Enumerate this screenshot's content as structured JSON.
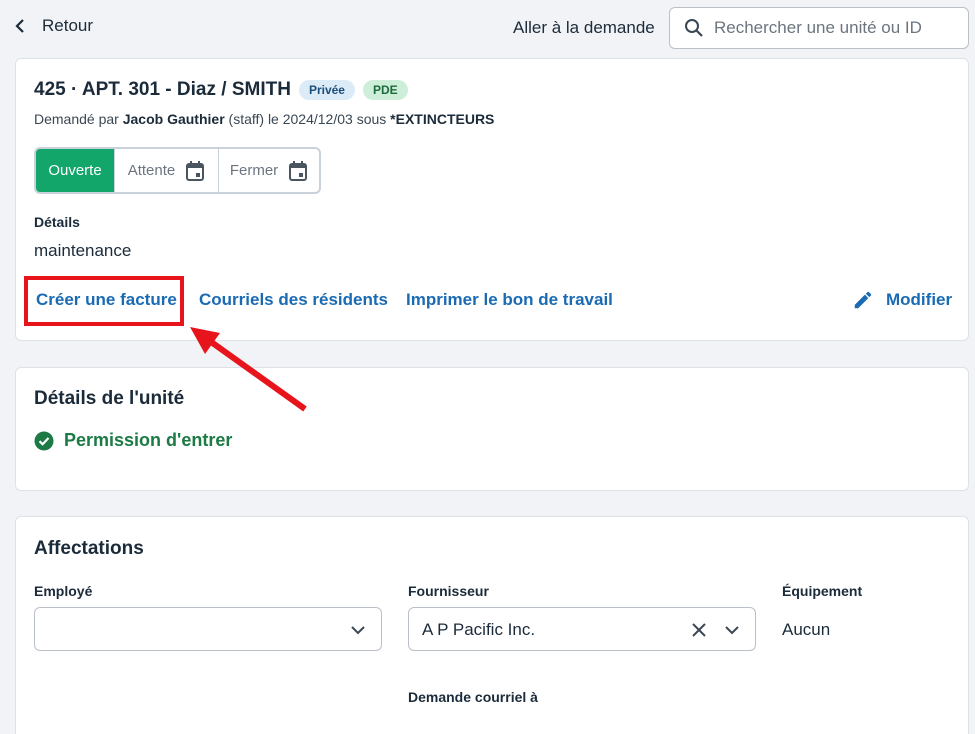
{
  "topbar": {
    "back_label": "Retour",
    "goto_label": "Aller à la demande",
    "search_placeholder": "Rechercher une unité ou ID",
    "search_value": ""
  },
  "request": {
    "title": "425 · APT. 301 - Diaz / SMITH",
    "badges": [
      "Privée",
      "PDE"
    ],
    "requested_prefix": "Demandé par ",
    "requester": "Jacob Gauthier",
    "requested_middle": " (staff) le 2024/12/03 sous ",
    "category": "*EXTINCTEURS",
    "status": {
      "open": "Ouverte",
      "waiting": "Attente",
      "closed": "Fermer",
      "active": "open"
    },
    "details_label": "Détails",
    "details_value": "maintenance",
    "actions": {
      "invoice": "Créer une facture",
      "emails": "Courriels des résidents",
      "print": "Imprimer le bon de travail",
      "edit": "Modifier"
    }
  },
  "unit": {
    "title": "Détails de l'unité",
    "permission": "Permission d'entrer"
  },
  "assignments": {
    "title": "Affectations",
    "employee_label": "Employé",
    "employee_value": "",
    "supplier_label": "Fournisseur",
    "supplier_value": "A P Pacific Inc.",
    "equipment_label": "Équipement",
    "equipment_value": "Aucun",
    "email_request_label": "Demande courriel à"
  },
  "colors": {
    "accent_link": "#1a6bb3",
    "status_open": "#12a66a",
    "success": "#1c7a45",
    "annotation_red": "#e8141c"
  },
  "icons": [
    "chevron-left-icon",
    "search-icon",
    "calendar-icon",
    "pencil-icon",
    "check-circle-icon",
    "close-icon",
    "chevron-down-icon",
    "annotation-arrow"
  ]
}
